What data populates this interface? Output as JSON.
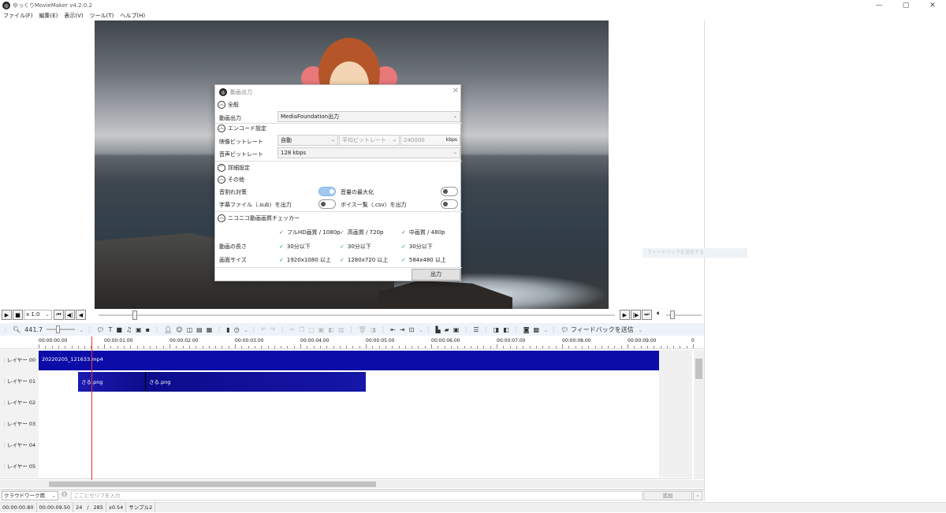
{
  "app": {
    "title": "ゆっくりMovieMaker v4.2.0.2",
    "icon_char": "ゆ"
  },
  "window_controls": [
    "—",
    "▢",
    "✕"
  ],
  "menu": [
    "ファイル(F)",
    "編集(E)",
    "表示(V)",
    "ツール(T)",
    "ヘルプ(H)"
  ],
  "dialog": {
    "title": "動画出力",
    "close": "✕",
    "sections": {
      "general": "全般",
      "encode": "エンコード設定",
      "detail": "詳細設定",
      "other": "その他",
      "nico": "ニコニコ動画画質チェッカー"
    },
    "video_output_label": "動画出力",
    "video_output_value": "MediaFoundation出力",
    "video_bitrate_label": "映像ビットレート",
    "video_bitrate_mode": "自動",
    "video_bitrate_type": "平均ビットレート",
    "video_bitrate_value": "240000",
    "video_bitrate_unit": "kbps",
    "audio_bitrate_label": "音声ビットレート",
    "audio_bitrate_value": "128 kbps",
    "toggles": {
      "crackle": {
        "label": "音割れ対策",
        "on": true
      },
      "maximize": {
        "label": "音量の最大化",
        "on": false
      },
      "subtitle": {
        "label": "字幕ファイル（.sub）を出力",
        "on": false
      },
      "voice_list": {
        "label": "ボイス一覧（.csv）を出力",
        "on": false
      }
    },
    "checker": {
      "headers": [
        "フルHD画質 / 1080p",
        "高画質 / 720p",
        "中画質 / 480p"
      ],
      "length_label": "動画の長さ",
      "length": [
        "30分以下",
        "30分以下",
        "30分以下"
      ],
      "size_label": "画面サイズ",
      "size": [
        "1920x1080 以上",
        "1280x720 以上",
        "584x480 以上"
      ],
      "check": "✓"
    },
    "output_button": "出力"
  },
  "ghost_text": "フィードバックを送信する",
  "transport": {
    "speed": "x 1.0"
  },
  "toolbar": {
    "zoom_value": "441.7",
    "feedback": "フィードバックを送信"
  },
  "timeline": {
    "ticks": [
      "00:00:00.00",
      "00:00:01.00",
      "00:00:02.00",
      "00:00:03.00",
      "00:00:04.00",
      "00:00:05.00",
      "00:00:06.00",
      "00:00:07.00",
      "00:00:08.00",
      "00:00:09.00",
      "0"
    ],
    "layers": [
      "レイヤー 00",
      "レイヤー 01",
      "レイヤー 02",
      "レイヤー 03",
      "レイヤー 04",
      "レイヤー 05"
    ],
    "clips": {
      "video": "20220205_121633.mp4",
      "img1": "さる.png",
      "img2": "さる.png"
    },
    "colors": {
      "video": "#0c0ca8",
      "image": "#1616a0"
    }
  },
  "input": {
    "preset": "クラウドワーク用",
    "placeholder": "ここにセリフを入力",
    "add": "追加"
  },
  "status": [
    "00:00:00.80",
    "00:00:09.50",
    "24",
    "/",
    "285",
    "x0.54",
    "サンプル2"
  ]
}
